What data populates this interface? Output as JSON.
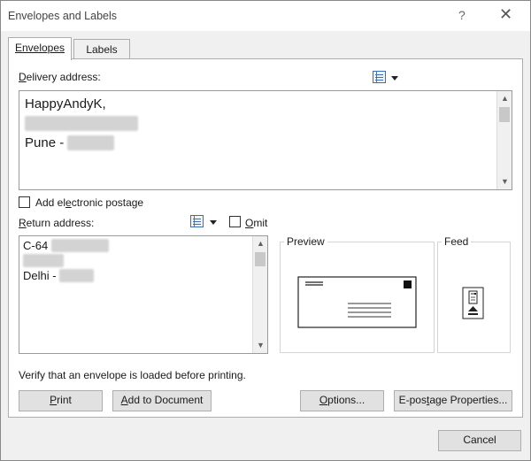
{
  "window": {
    "title": "Envelopes and Labels",
    "help_glyph": "?",
    "close_glyph": "✕"
  },
  "tabs": [
    {
      "label": "Envelopes",
      "active": true
    },
    {
      "label": "Labels",
      "active": false
    }
  ],
  "delivery": {
    "label_prefix": "",
    "label_accel": "D",
    "label_rest": "elivery address:",
    "lines": [
      "HappyAndyK,",
      "",
      "Pune - "
    ]
  },
  "postage": {
    "label_pre": "Add el",
    "label_accel": "e",
    "label_post": "ctronic postage",
    "checked": false
  },
  "return_address": {
    "label_accel": "R",
    "label_rest": "eturn address:",
    "omit_pre": "",
    "omit_accel": "O",
    "omit_post": "mit",
    "omit_checked": false,
    "lines": [
      "C-64 ",
      "",
      "Delhi - "
    ]
  },
  "preview": {
    "title": "Preview"
  },
  "feed": {
    "title": "Feed"
  },
  "note": "Verify that an envelope is loaded before printing.",
  "buttons": {
    "print": {
      "accel": "P",
      "rest": "rint"
    },
    "add_to_document": {
      "accel": "A",
      "rest": "dd to Document"
    },
    "options": {
      "accel": "O",
      "rest": "ptions..."
    },
    "epostage": {
      "pre": "E-pos",
      "accel": "t",
      "post": "age Properties..."
    },
    "cancel": "Cancel"
  },
  "colors": {
    "accent_blue": "#3a6fb8",
    "dialog_bg": "#f0f0f0",
    "button_bg": "#e1e1e1"
  }
}
